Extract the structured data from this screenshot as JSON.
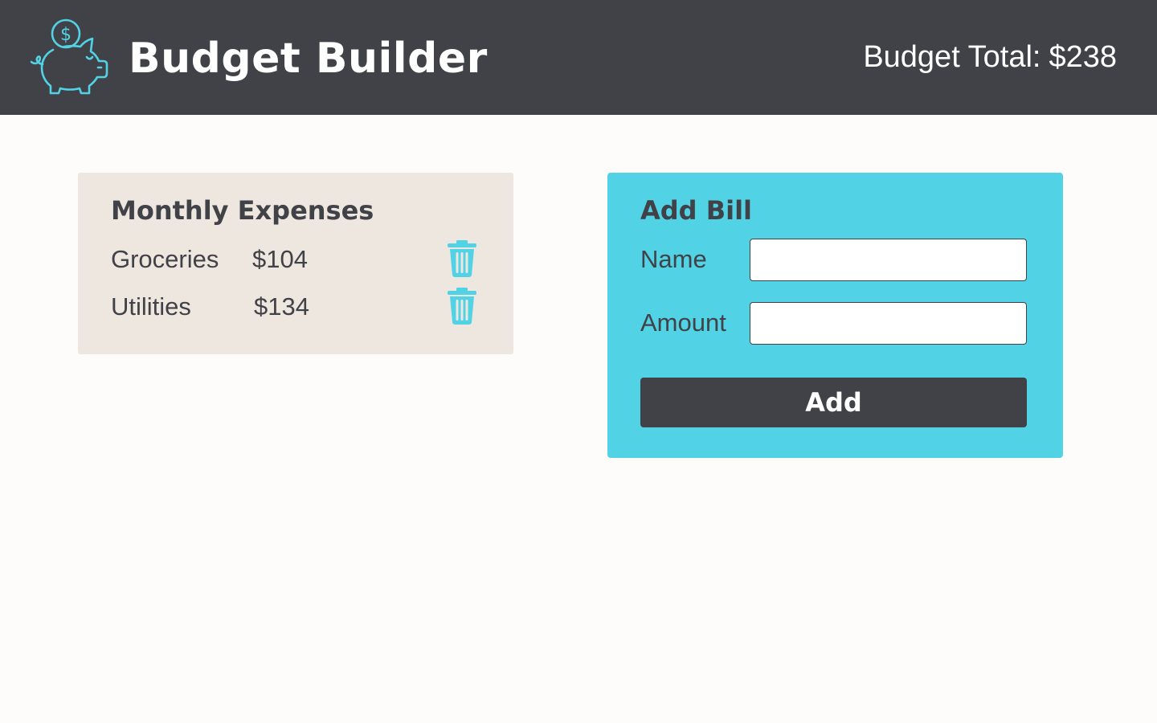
{
  "header": {
    "logo_icon": "piggy-bank-icon",
    "title": "Budget Builder",
    "budget_total_label": "Budget Total:",
    "budget_total_value": "$238"
  },
  "expenses": {
    "heading": "Monthly Expenses",
    "items": [
      {
        "name": "Groceries",
        "amount": "$104",
        "delete_icon": "trash-icon"
      },
      {
        "name": "Utilities",
        "amount": "$134",
        "delete_icon": "trash-icon"
      }
    ]
  },
  "add_bill": {
    "heading": "Add Bill",
    "name_label": "Name",
    "name_value": "",
    "amount_label": "Amount",
    "amount_value": "",
    "button_label": "Add"
  },
  "colors": {
    "header_bg": "#414248",
    "accent": "#52d2e5",
    "expenses_card_bg": "#ede7e0",
    "page_bg": "#fdfcfa",
    "text_dark": "#414248"
  }
}
